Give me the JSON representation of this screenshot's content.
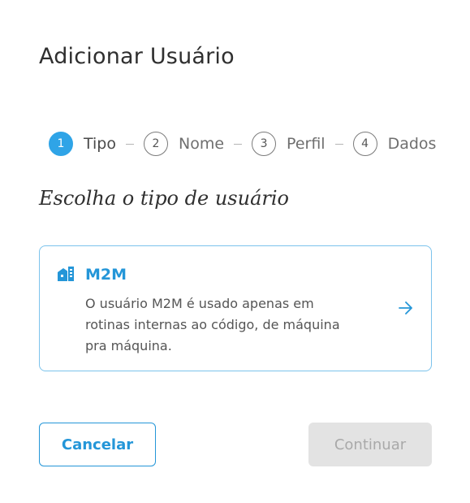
{
  "dialog": {
    "title": "Adicionar Usuário",
    "subtitle": "Escolha o tipo de usuário"
  },
  "stepper": {
    "steps": [
      {
        "number": "1",
        "label": "Tipo",
        "active": true
      },
      {
        "number": "2",
        "label": "Nome",
        "active": false
      },
      {
        "number": "3",
        "label": "Perfil",
        "active": false
      },
      {
        "number": "4",
        "label": "Dados",
        "active": false
      }
    ]
  },
  "user_types": [
    {
      "title": "M2M",
      "description": "O usuário M2M é usado apenas em rotinas internas ao código, de máquina pra máquina.",
      "icon": "building-icon",
      "action_icon": "arrow-right-icon"
    }
  ],
  "buttons": {
    "cancel_label": "Cancelar",
    "continue_label": "Continuar",
    "continue_disabled": true
  },
  "colors": {
    "accent": "#2496d8",
    "step_active": "#2fa4e7",
    "card_border": "#7cc3ec",
    "disabled_bg": "#e3e3e3",
    "disabled_text": "#a9a9a9"
  }
}
